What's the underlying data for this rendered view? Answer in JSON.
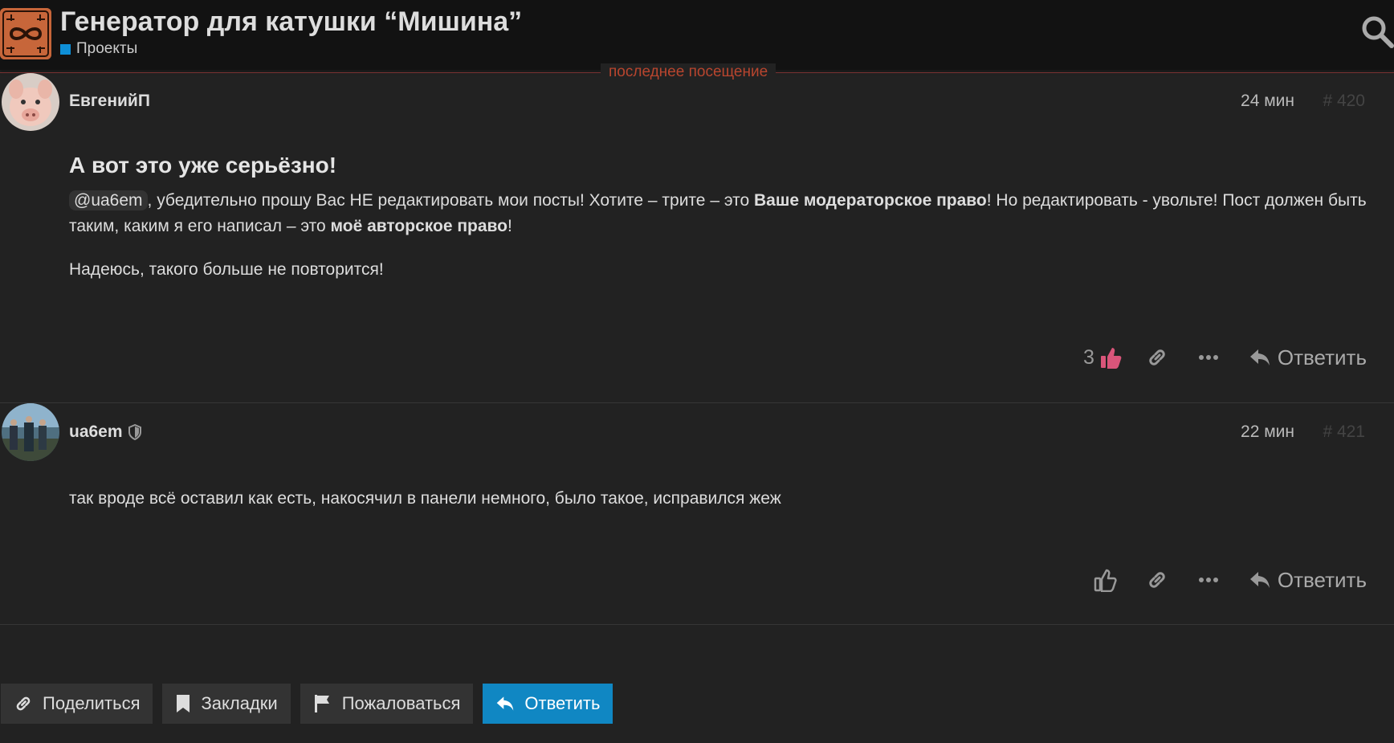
{
  "header": {
    "title": "Генератор для катушки “Мишина”",
    "category": "Проекты",
    "category_color": "#0e8fd7"
  },
  "last_visit_label": "последнее посещение",
  "posts": [
    {
      "username": "ЕвгенийП",
      "time": "24 мин",
      "number": "# 420",
      "heading": "А вот это уже серьёзно!",
      "p1_mention": "@ua6em",
      "p1_text_a": ", убедительно прошу Вас НЕ редактировать мои посты! Хотите – трите – это ",
      "p1_bold_a": "Ваше модераторское право",
      "p1_text_b": "! Но редактировать - увольте! Пост должен быть таким, каким я его написал – это ",
      "p1_bold_b": "моё авторское право",
      "p1_text_c": "!",
      "p2": "Надеюсь, такого больше не повторится!",
      "like_count": "3",
      "reply_label": "Ответить"
    },
    {
      "username": "ua6em",
      "time": "22 мин",
      "number": "# 421",
      "p1": "так вроде всё оставил как есть, накосячил в панели немного, было такое, исправился жеж",
      "reply_label": "Ответить"
    }
  ],
  "footer": {
    "share": "Поделиться",
    "bookmarks": "Закладки",
    "flag": "Пожаловаться",
    "reply": "Ответить"
  },
  "colors": {
    "background": "#222222",
    "header_bg": "#121212",
    "accent": "#1087c3",
    "liked": "#d9557a",
    "last_visit": "#b8452e"
  }
}
